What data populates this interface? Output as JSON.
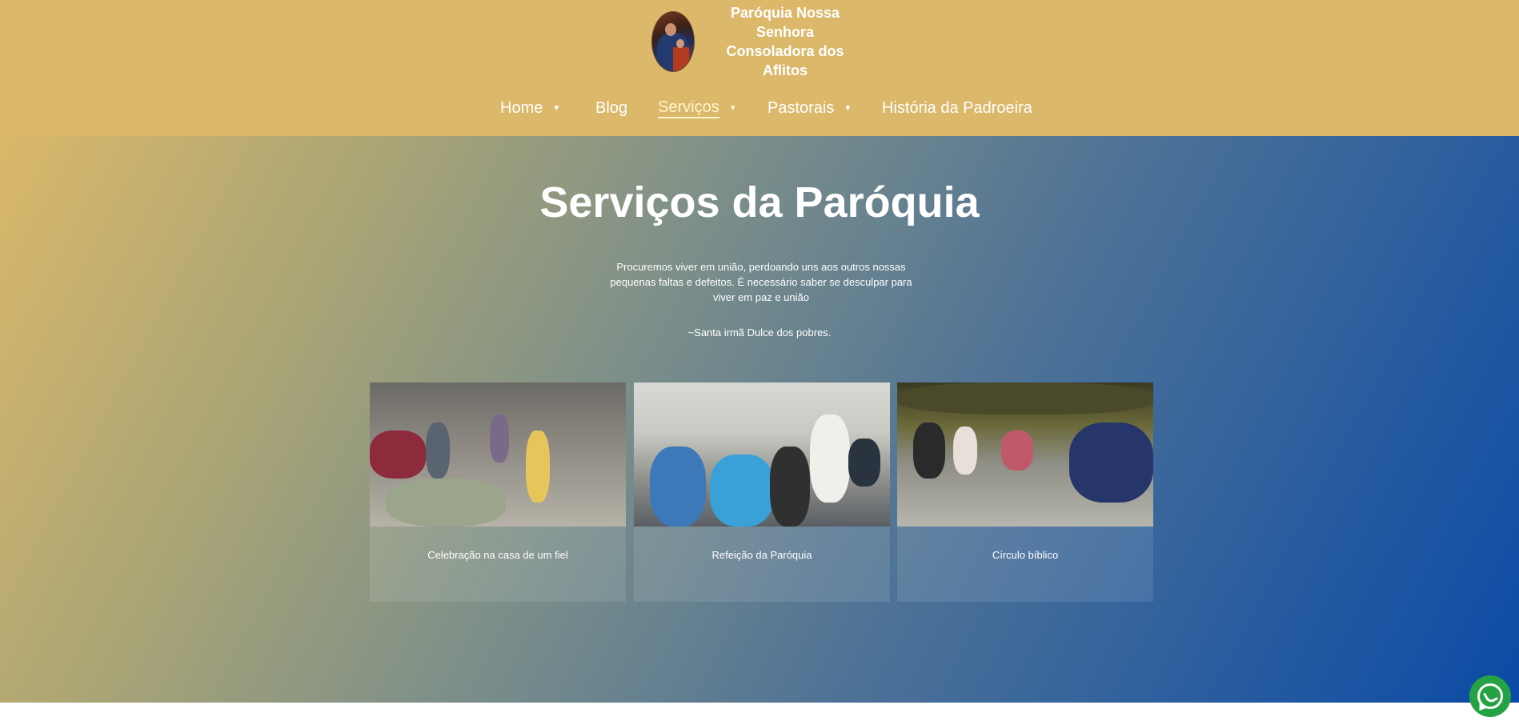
{
  "header": {
    "logo_line1": "Paróquia Nossa Senhora",
    "logo_line2": "Consoladora dos Aflitos",
    "logo_icon": "our-lady-image"
  },
  "nav": {
    "items": [
      {
        "label": "Home",
        "has_dropdown": true
      },
      {
        "label": "Blog",
        "has_dropdown": false
      },
      {
        "label": "Serviços",
        "has_dropdown": true,
        "active": true
      },
      {
        "label": "Pastorais",
        "has_dropdown": true
      },
      {
        "label": "História da Padroeira",
        "has_dropdown": false
      }
    ],
    "caret": "▼"
  },
  "hero": {
    "title": "Serviços da Paróquia",
    "quote": "Procuremos viver em união, perdoando uns aos outros nossas pequenas faltas e defeitos. É necessário saber se desculpar para viver em paz e união",
    "author": "~Santa irmã Dulce dos pobres."
  },
  "cards": [
    {
      "caption": "Celebração na casa de um fiel"
    },
    {
      "caption": "Refeição da Paróquia"
    },
    {
      "caption": "Círculo bíblico"
    }
  ],
  "colors": {
    "header_bg": "#dbb86a",
    "gradient_end": "#0a4aa6",
    "whatsapp": "#25a244"
  },
  "floating": {
    "icon": "whatsapp-icon"
  }
}
